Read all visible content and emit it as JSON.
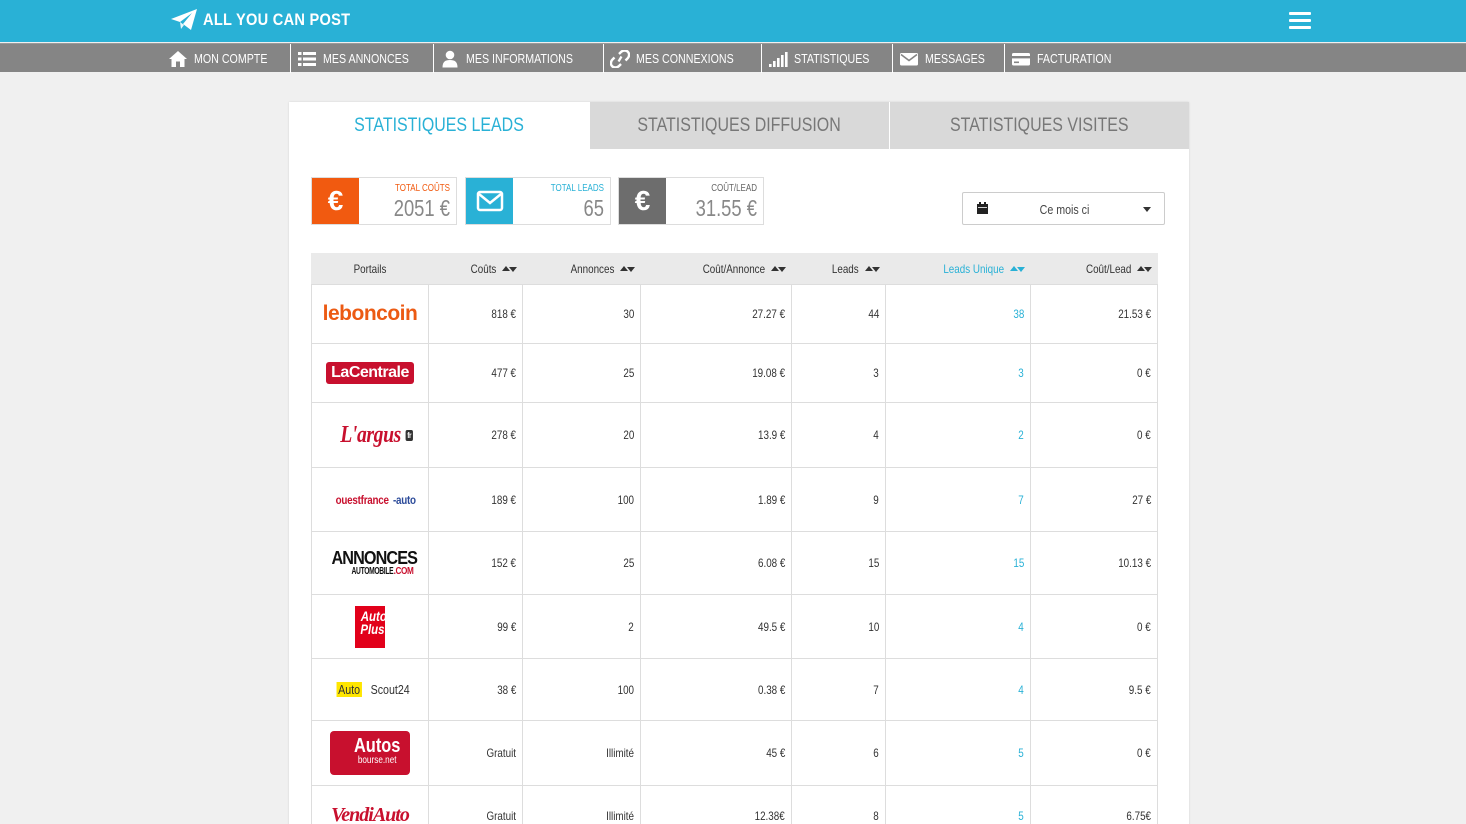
{
  "header": {
    "app_title": "ALL YOU CAN POST"
  },
  "nav": [
    {
      "label": "MON COMPTE",
      "icon": "home-icon"
    },
    {
      "label": "MES ANNONCES",
      "icon": "list-icon"
    },
    {
      "label": "MES INFORMATIONS",
      "icon": "user-icon"
    },
    {
      "label": "MES CONNEXIONS",
      "icon": "link-icon"
    },
    {
      "label": "STATISTIQUES",
      "icon": "bar-signal-icon"
    },
    {
      "label": "MESSAGES",
      "icon": "envelope-icon"
    },
    {
      "label": "FACTURATION",
      "icon": "credit-card-icon"
    }
  ],
  "tabs": [
    {
      "label": "STATISTIQUES LEADS",
      "active": true
    },
    {
      "label": "STATISTIQUES DIFFUSION",
      "active": false
    },
    {
      "label": "STATISTIQUES VISITES",
      "active": false
    }
  ],
  "stats": [
    {
      "label": "TOTAL COÛTS",
      "value": "2051 €",
      "icon": "euro-icon",
      "color": "#f15a10",
      "label_color": "#f15a10"
    },
    {
      "label": "TOTAL LEADS",
      "value": "65",
      "icon": "envelope-icon",
      "color": "#29b1d6",
      "label_color": "#29b1d6"
    },
    {
      "label": "COÛT/LEAD",
      "value": "31.55 €",
      "icon": "euro-icon",
      "color": "#6d6d6d",
      "label_color": "#666666"
    }
  ],
  "date_filter": {
    "value": "Ce mois ci"
  },
  "table": {
    "columns": [
      "Portails",
      "Coûts",
      "Annonces",
      "Coût/Annonce",
      "Leads",
      "Leads Unique",
      "Coût/Lead"
    ],
    "rows": [
      {
        "portal": "leboncoin",
        "cout": "818 €",
        "annonces": "30",
        "cout_annonce": "27.27 €",
        "leads": "44",
        "leads_unique": "38",
        "cout_lead": "21.53 €"
      },
      {
        "portal": "LaCentrale",
        "cout": "477 €",
        "annonces": "25",
        "cout_annonce": "19.08 €",
        "leads": "3",
        "leads_unique": "3",
        "cout_lead": "0 €"
      },
      {
        "portal": "L'argus",
        "cout": "278 €",
        "annonces": "20",
        "cout_annonce": "13.9 €",
        "leads": "4",
        "leads_unique": "2",
        "cout_lead": "0 €"
      },
      {
        "portal": "ouestfrance-auto",
        "cout": "189 €",
        "annonces": "100",
        "cout_annonce": "1.89 €",
        "leads": "9",
        "leads_unique": "7",
        "cout_lead": "27 €"
      },
      {
        "portal": "ANNONCES AUTOMOBILE.COM",
        "cout": "152 €",
        "annonces": "25",
        "cout_annonce": "6.08 €",
        "leads": "15",
        "leads_unique": "15",
        "cout_lead": "10.13 €"
      },
      {
        "portal": "Auto Plus",
        "cout": "99 €",
        "annonces": "2",
        "cout_annonce": "49.5 €",
        "leads": "10",
        "leads_unique": "4",
        "cout_lead": "0 €"
      },
      {
        "portal": "AutoScout24",
        "cout": "38 €",
        "annonces": "100",
        "cout_annonce": "0.38 €",
        "leads": "7",
        "leads_unique": "4",
        "cout_lead": "9.5 €"
      },
      {
        "portal": "Autos bourse.net",
        "cout": "Gratuit",
        "annonces": "Illimité",
        "cout_annonce": "45 €",
        "leads": "6",
        "leads_unique": "5",
        "cout_lead": "0 €"
      },
      {
        "portal": "VendiAuto",
        "cout": "Gratuit",
        "annonces": "Illimité",
        "cout_annonce": "12.38€",
        "leads": "8",
        "leads_unique": "5",
        "cout_lead": "6.75€"
      }
    ]
  },
  "logos": {
    "leboncoin": "leboncoin",
    "lacentrale": "LaCentrale",
    "largus": "L'argus",
    "largus_fr": "fr",
    "ouest_a": "ouestfrance",
    "ouest_b": "-auto",
    "annonces_t": "ANNONCES",
    "annonces_s1": "AUTOMOBILE",
    "annonces_s2": ".COM",
    "autoplus_1": "Auto",
    "autoplus_2": "Plus",
    "autoscout_hl": "Auto",
    "autoscout_rest": "Scout24",
    "autosbourse_t": "Autos",
    "autosbourse_s": "bourse.net",
    "vendiauto": "VendiAuto"
  }
}
